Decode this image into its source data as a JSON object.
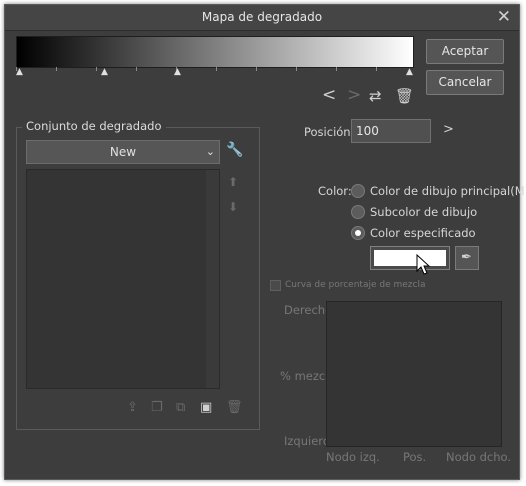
{
  "window": {
    "title": "Mapa de degradado",
    "close_icon": "close-icon"
  },
  "buttons": {
    "accept": "Aceptar",
    "cancel": "Cancelar"
  },
  "gradient": {
    "start_color": "#000000",
    "end_color": "#ffffff"
  },
  "position": {
    "label": "Posición:",
    "value": "100"
  },
  "gradient_set": {
    "group_label": "Conjunto de degradado",
    "selected": "New"
  },
  "color": {
    "label": "Color:",
    "options": [
      "Color de dibujo principal(M)",
      "Subcolor de dibujo",
      "Color especificado"
    ],
    "selected_index": 2,
    "specified_color": "#ffffff"
  },
  "curve": {
    "checkbox_label": "Curva de porcentaje de mezcla",
    "left_right": "Derecho",
    "mix": "% mezcla",
    "left": "Izquierdo",
    "bottom_labels": [
      "Nodo izq.",
      "Pos.",
      "Nodo dcho."
    ]
  }
}
